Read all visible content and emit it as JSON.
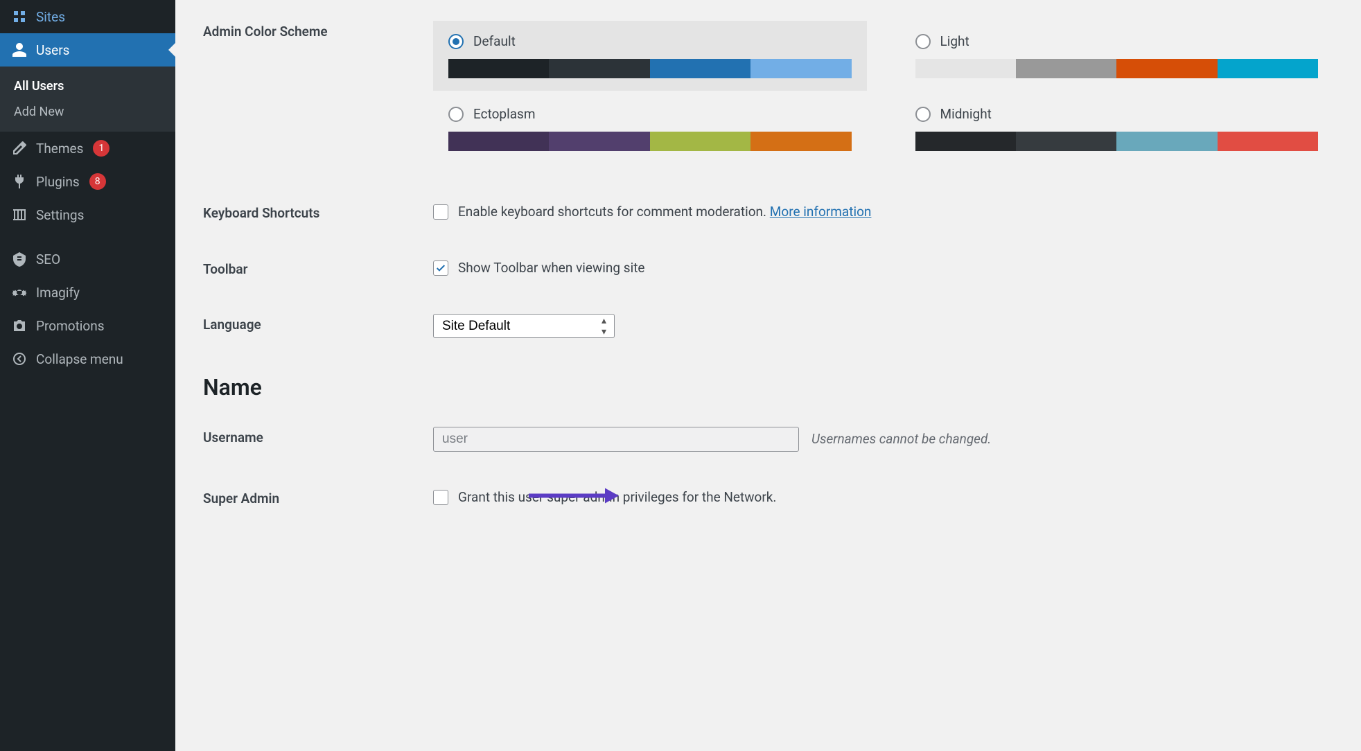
{
  "sidebar": {
    "items": [
      {
        "label": "Sites",
        "icon": "sites-icon",
        "active": false
      },
      {
        "label": "Users",
        "icon": "users-icon",
        "active": true
      },
      {
        "label": "Themes",
        "icon": "themes-icon",
        "active": false,
        "badge": 1
      },
      {
        "label": "Plugins",
        "icon": "plugins-icon",
        "active": false,
        "badge": 8
      },
      {
        "label": "Settings",
        "icon": "settings-icon",
        "active": false
      },
      {
        "label": "SEO",
        "icon": "seo-icon",
        "active": false
      },
      {
        "label": "Imagify",
        "icon": "imagify-icon",
        "active": false
      },
      {
        "label": "Promotions",
        "icon": "promotions-icon",
        "active": false
      }
    ],
    "sub_items": [
      {
        "label": "All Users",
        "current": true
      },
      {
        "label": "Add New",
        "current": false
      }
    ],
    "collapse_label": "Collapse menu"
  },
  "fields": {
    "admin_color_scheme_label": "Admin Color Scheme",
    "keyboard_shortcuts_label": "Keyboard Shortcuts",
    "keyboard_shortcuts_checkbox": "Enable keyboard shortcuts for comment moderation.",
    "keyboard_shortcuts_link": "More information",
    "toolbar_label": "Toolbar",
    "toolbar_checkbox": "Show Toolbar when viewing site",
    "language_label": "Language",
    "language_value": "Site Default",
    "name_heading": "Name",
    "username_label": "Username",
    "username_value": "user",
    "username_desc": "Usernames cannot be changed.",
    "super_admin_label": "Super Admin",
    "super_admin_checkbox": "Grant this user super admin privileges for the Network."
  },
  "color_schemes": [
    {
      "name": "Default",
      "swatches": [
        "#1d2327",
        "#2c3338",
        "#2271b1",
        "#72aee6"
      ],
      "checked": true,
      "bg": true
    },
    {
      "name": "Light",
      "swatches": [
        "#e5e5e5",
        "#999999",
        "#d64e07",
        "#04a4cc"
      ],
      "checked": false,
      "bg": false
    },
    {
      "name": "Ectoplasm",
      "swatches": [
        "#413256",
        "#523f6d",
        "#a3b745",
        "#d46f15"
      ],
      "checked": false,
      "bg": false
    },
    {
      "name": "Midnight",
      "swatches": [
        "#25282b",
        "#363b3f",
        "#69a8bb",
        "#e14d43"
      ],
      "checked": false,
      "bg": false
    }
  ]
}
